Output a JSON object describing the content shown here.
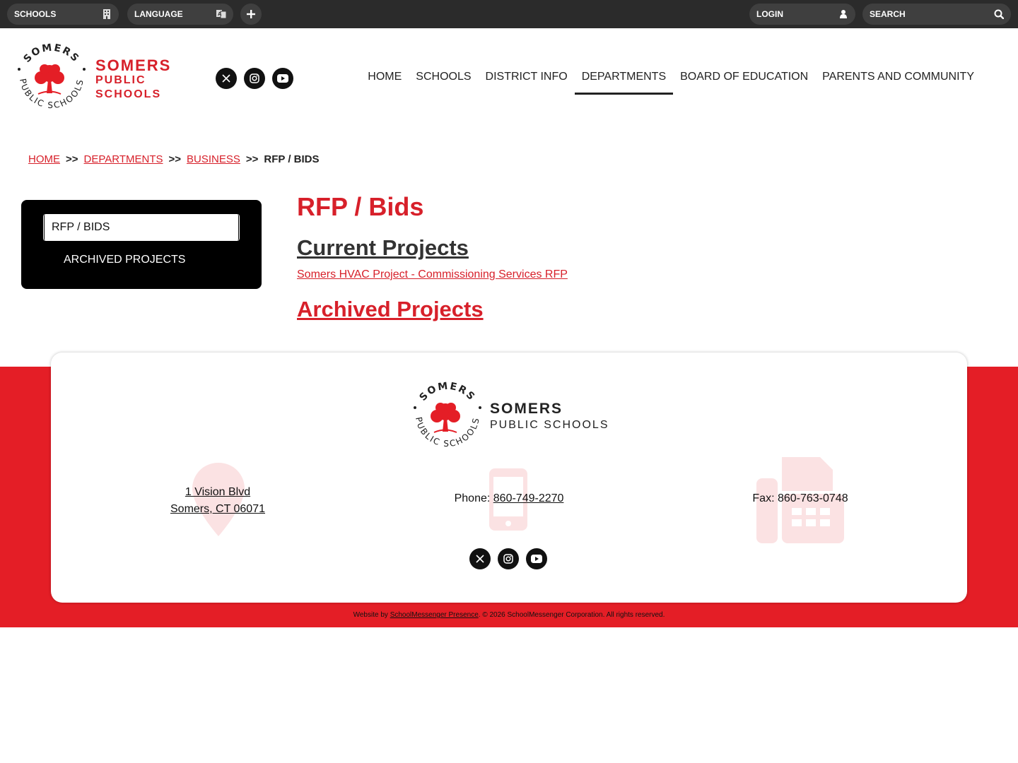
{
  "topbar": {
    "schools_label": "SCHOOLS",
    "language_label": "LANGUAGE",
    "login_label": "LOGIN",
    "search_placeholder": "SEARCH"
  },
  "logo": {
    "ring_top": "SOMERS",
    "ring_bottom": "PUBLIC SCHOOLS",
    "line1": "SOMERS",
    "line2": "PUBLIC",
    "line3": "SCHOOLS"
  },
  "nav": {
    "items": [
      {
        "label": "HOME"
      },
      {
        "label": "SCHOOLS"
      },
      {
        "label": "DISTRICT INFO"
      },
      {
        "label": "DEPARTMENTS"
      },
      {
        "label": "BOARD OF EDUCATION"
      },
      {
        "label": "PARENTS AND COMMUNITY"
      }
    ],
    "active": "DEPARTMENTS"
  },
  "breadcrumb": {
    "home": "HOME",
    "departments": "DEPARTMENTS",
    "business": "BUSINESS",
    "current": "RFP / BIDS",
    "sep": ">>"
  },
  "sidebar": {
    "active_item": "RFP / BIDS",
    "item2": "ARCHIVED PROJECTS"
  },
  "content": {
    "title": "RFP / Bids",
    "current_heading": "Current Projects",
    "hvac_link": "Somers HVAC Project - Commissioning Services RFP",
    "archived_heading": "Archived Projects"
  },
  "footer": {
    "name_line1": "SOMERS",
    "name_line2": "PUBLIC SCHOOLS",
    "address_line1": "1 Vision Blvd",
    "address_line2": "Somers, CT 06071",
    "phone_label": "Phone:",
    "phone_number": "860-749-2270",
    "fax_text": "Fax: 860-763-0748",
    "copyright_prefix": "Website by",
    "copyright_link": "SchoolMessenger Presence",
    "copyright_suffix": ". © 2026 SchoolMessenger Corporation. All rights reserved."
  },
  "colors": {
    "brand_red": "#d7202a",
    "footer_red": "#e41e26",
    "topbar": "#2b2b2b"
  },
  "icons": [
    "building-icon",
    "translate-icon",
    "plus-icon",
    "user-icon",
    "search-icon",
    "x-twitter-icon",
    "instagram-icon",
    "youtube-icon",
    "map-pin-icon",
    "phone-icon",
    "fax-icon"
  ]
}
